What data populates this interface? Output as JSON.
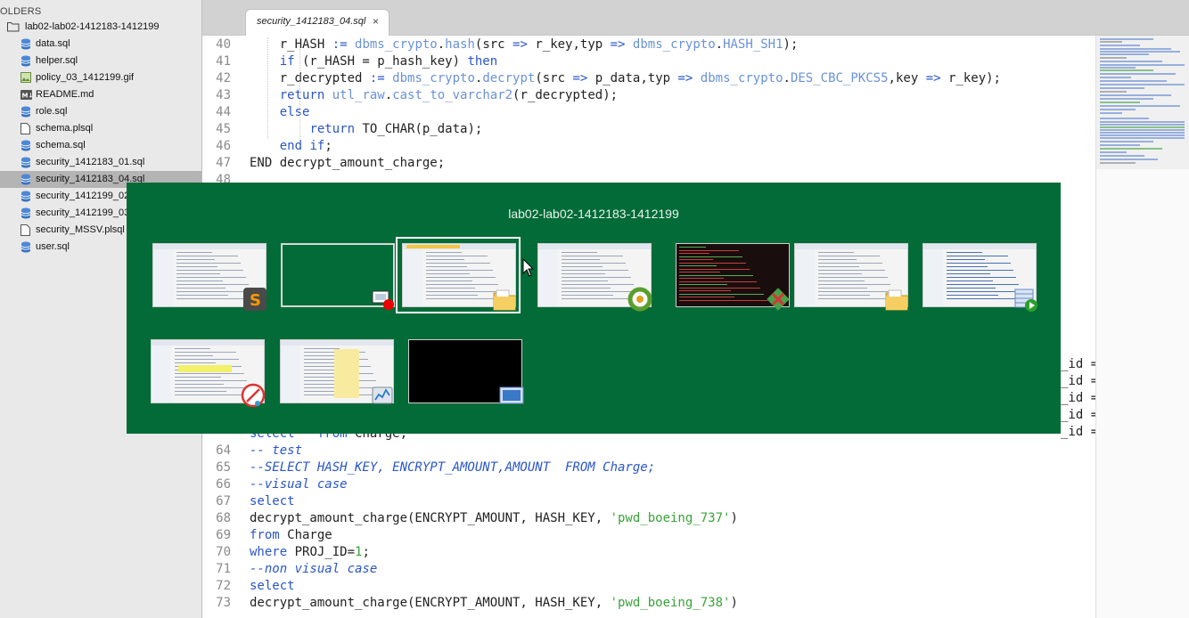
{
  "sidebar": {
    "header": "OLDERS",
    "root": "lab02-lab02-1412183-1412199",
    "files": [
      {
        "name": "data.sql",
        "icon": "database-icon"
      },
      {
        "name": "helper.sql",
        "icon": "database-icon"
      },
      {
        "name": "policy_03_1412199.gif",
        "icon": "image-icon"
      },
      {
        "name": "README.md",
        "icon": "markdown-icon"
      },
      {
        "name": "role.sql",
        "icon": "database-icon"
      },
      {
        "name": "schema.plsql",
        "icon": "file-icon"
      },
      {
        "name": "schema.sql",
        "icon": "database-icon"
      },
      {
        "name": "security_1412183_01.sql",
        "icon": "database-icon"
      },
      {
        "name": "security_1412183_04.sql",
        "icon": "database-icon",
        "selected": true
      },
      {
        "name": "security_1412199_02",
        "icon": "database-icon"
      },
      {
        "name": "security_1412199_03",
        "icon": "database-icon"
      },
      {
        "name": "security_MSSV.plsql",
        "icon": "file-icon"
      },
      {
        "name": "user.sql",
        "icon": "database-icon"
      }
    ]
  },
  "editor": {
    "tab_label": "security_1412183_04.sql",
    "tab_close": "×",
    "lines_top": [
      {
        "n": "40",
        "code": "    r_HASH := dbms_crypto.hash(src => r_key,typ => dbms_crypto.HASH_SH1);"
      },
      {
        "n": "41",
        "code": "    if (r_HASH = p_hash_key) then"
      },
      {
        "n": "42",
        "code": "    r_decrypted := dbms_crypto.decrypt(src => p_data,typ => dbms_crypto.DES_CBC_PKCS5,key => r_key);"
      },
      {
        "n": "43",
        "code": "    return utl_raw.cast_to_varchar2(r_decrypted);"
      },
      {
        "n": "44",
        "code": "    else"
      },
      {
        "n": "45",
        "code": "        return TO_CHAR(p_data);"
      },
      {
        "n": "46",
        "code": "    end if;"
      },
      {
        "n": "47",
        "code": "END decrypt_amount_charge;"
      },
      {
        "n": "48",
        "code": ""
      }
    ],
    "partial_right": [
      "_id =",
      "_id =",
      "_id =",
      "_id =",
      "_id ="
    ],
    "line_63_fragment": "select * from Charge;",
    "lines_bottom": [
      {
        "n": "64",
        "code": "-- test"
      },
      {
        "n": "65",
        "code": "--SELECT HASH_KEY, ENCRYPT_AMOUNT,AMOUNT  FROM Charge;"
      },
      {
        "n": "66",
        "code": "--visual case"
      },
      {
        "n": "67",
        "code": "select"
      },
      {
        "n": "68",
        "code": "decrypt_amount_charge(ENCRYPT_AMOUNT, HASH_KEY, 'pwd_boeing_737')"
      },
      {
        "n": "69",
        "code": "from Charge"
      },
      {
        "n": "70",
        "code": "where PROJ_ID=1;"
      },
      {
        "n": "71",
        "code": "--non visual case"
      },
      {
        "n": "72",
        "code": "select"
      },
      {
        "n": "73",
        "code": "decrypt_amount_charge(ENCRYPT_AMOUNT, HASH_KEY, 'pwd_boeing_738')"
      }
    ]
  },
  "switcher": {
    "title": "lab02-lab02-1412183-1412199",
    "row1": [
      {
        "name": "Sublime Text",
        "badge": "sublime-icon"
      },
      {
        "name": "Screen recorder",
        "badge": "record-icon"
      },
      {
        "name": "File Explorer",
        "badge": "folder-icon",
        "selected": true
      },
      {
        "name": "Browser",
        "badge": "browser-icon"
      },
      {
        "name": "Git Bash",
        "badge": "git-icon"
      },
      {
        "name": "File Explorer",
        "badge": "folder-icon"
      },
      {
        "name": "SQL Developer",
        "badge": "sql-icon"
      }
    ],
    "row2": [
      {
        "name": "Snipping Tool",
        "badge": "scissors-icon"
      },
      {
        "name": "Task Manager",
        "badge": "task-manager-icon"
      },
      {
        "name": "Remote Desktop",
        "badge": "remote-desktop-icon"
      }
    ]
  },
  "colors": {
    "switcher_bg": "#036b38",
    "keyword": "#2a56c9",
    "string": "#3aa33a",
    "selected_row": "#b4b4b4"
  }
}
